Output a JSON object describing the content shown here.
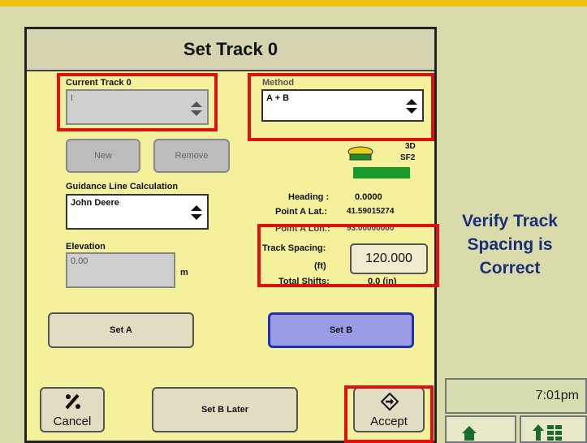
{
  "dialog": {
    "title": "Set Track 0",
    "current_track": {
      "label": "Current Track 0",
      "value": "I"
    },
    "method": {
      "label": "Method",
      "value": "A + B"
    },
    "new_label": "New",
    "remove_label": "Remove",
    "gps": {
      "mode": "3D",
      "signal": "SF2",
      "bar_color": "#1a9a2a"
    },
    "guidance": {
      "label": "Guidance Line Calculation",
      "value": "John Deere"
    },
    "elevation": {
      "label": "Elevation",
      "value": "0.00",
      "unit": "m"
    },
    "heading": {
      "label": "Heading :",
      "value": "0.0000"
    },
    "point_a_lat": {
      "label": "Point A Lat.:",
      "value": "41.59015274"
    },
    "point_a_lon": {
      "label": "Point A Lon.:",
      "value": "93.00000000"
    },
    "track_spacing": {
      "label": "Track Spacing:",
      "unit": "(ft)",
      "value": "120.000"
    },
    "total_shifts": {
      "label": "Total Shifts:",
      "value": "0.0 (in)"
    },
    "set_a_label": "Set A",
    "set_b_label": "Set B",
    "cancel_label": "Cancel",
    "set_b_later_label": "Set B Later",
    "accept_label": "Accept"
  },
  "annotation": {
    "text": "Verify Track Spacing is Correct",
    "color": "#1a2e7a"
  },
  "status": {
    "time": "7:01pm"
  },
  "colors": {
    "highlight": "#e01010",
    "panel": "#f4f09c",
    "accent": "#f0c010"
  }
}
